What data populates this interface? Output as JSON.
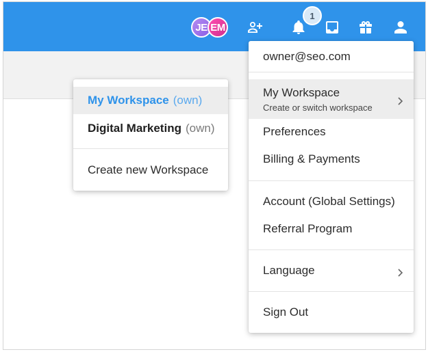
{
  "header": {
    "avatars": [
      "JE",
      "EM"
    ],
    "notification_count": "1",
    "icons": [
      "add-user-icon",
      "bell-icon",
      "inbox-icon",
      "gift-icon",
      "user-icon"
    ],
    "accent_color": "#2f93ea"
  },
  "account_menu": {
    "email": "owner@seo.com",
    "workspace": {
      "label": "My Workspace",
      "sublabel": "Create or switch workspace"
    },
    "preferences": "Preferences",
    "billing": "Billing & Payments",
    "account": "Account (Global Settings)",
    "referral": "Referral Program",
    "language": "Language",
    "sign_out": "Sign Out"
  },
  "workspace_menu": {
    "items": [
      {
        "name": "My Workspace",
        "tag": "(own)"
      },
      {
        "name": "Digital Marketing",
        "tag": "(own)"
      }
    ],
    "create": "Create new Workspace"
  }
}
